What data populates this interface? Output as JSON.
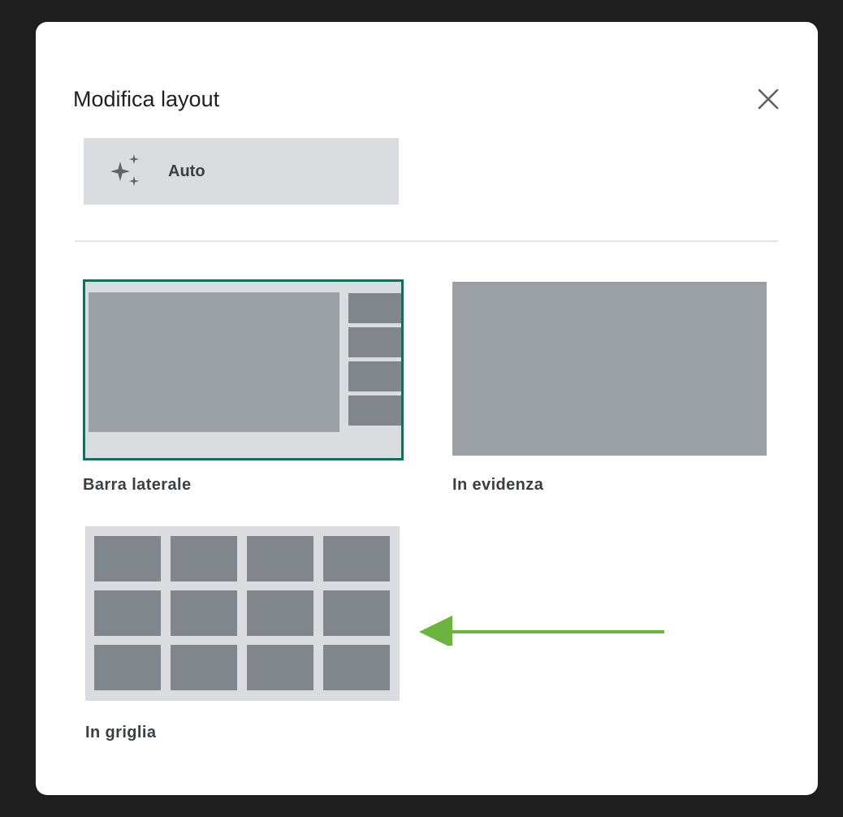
{
  "dialog": {
    "title": "Modifica layout",
    "close_icon": "close-icon",
    "auto_button": {
      "label": "Auto",
      "icon": "sparkle-icon"
    },
    "layout_options": [
      {
        "id": "sidebar",
        "label": "Barra laterale",
        "selected": true
      },
      {
        "id": "spotlight",
        "label": "In evidenza",
        "selected": false
      },
      {
        "id": "tiled",
        "label": "In griglia",
        "selected": false
      }
    ]
  },
  "annotation": {
    "icon": "arrow-left-icon",
    "color": "#6cb33f"
  },
  "colors": {
    "selected_border": "#1b6b5b",
    "thumb_background": "#dadce0",
    "thumb_main": "#9aa0a6",
    "thumb_tile": "#80868b",
    "backdrop": "#1e1e1e"
  }
}
